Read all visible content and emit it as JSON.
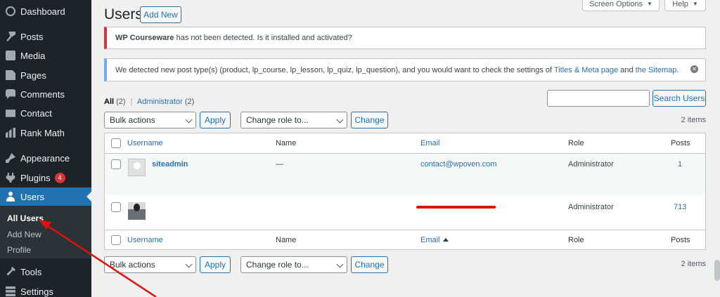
{
  "sidebar": {
    "items": [
      {
        "label": "Dashboard",
        "icon": "dashboard-icon"
      },
      {
        "label": "Posts",
        "icon": "pin-icon"
      },
      {
        "label": "Media",
        "icon": "media-icon"
      },
      {
        "label": "Pages",
        "icon": "pages-icon"
      },
      {
        "label": "Comments",
        "icon": "comments-icon"
      },
      {
        "label": "Contact",
        "icon": "mail-icon"
      },
      {
        "label": "Rank Math",
        "icon": "chart-icon"
      },
      {
        "label": "Appearance",
        "icon": "brush-icon"
      },
      {
        "label": "Plugins",
        "icon": "plug-icon",
        "badge": "4"
      },
      {
        "label": "Users",
        "icon": "user-icon"
      },
      {
        "label": "Tools",
        "icon": "wrench-icon"
      },
      {
        "label": "Settings",
        "icon": "settings-icon"
      }
    ],
    "submenu": [
      "All Users",
      "Add New",
      "Profile"
    ]
  },
  "header": {
    "title": "Users",
    "add_new": "Add New",
    "screen_options": "Screen Options",
    "help": "Help"
  },
  "notices": {
    "error_strong": "WP Courseware",
    "error_text": " has not been detected. Is it installed and activated?",
    "info_text": "We detected new post type(s) (product, lp_course, lp_lesson, lp_quiz, lp_question), and you would want to check the settings of ",
    "info_link1": "Titles & Meta page",
    "info_and": " and ",
    "info_link2": "the Sitemap",
    "info_end": "."
  },
  "filters": {
    "all": "All",
    "all_count": "(2)",
    "sep": "|",
    "admin": "Administrator",
    "admin_count": "(2)"
  },
  "search": {
    "button": "Search Users",
    "placeholder": ""
  },
  "tablenav": {
    "bulk": "Bulk actions",
    "apply": "Apply",
    "role": "Change role to...",
    "change": "Change",
    "items": "2 items"
  },
  "table": {
    "columns": {
      "username": "Username",
      "name": "Name",
      "email": "Email",
      "role": "Role",
      "posts": "Posts"
    },
    "rows": [
      {
        "username": "siteadmin",
        "name": "—",
        "email": "contact@wpoven.com",
        "role": "Administrator",
        "posts": "1"
      },
      {
        "username": "",
        "name": "",
        "email": "",
        "role": "Administrator",
        "posts": "713"
      }
    ]
  },
  "colors": {
    "accent": "#2271b1",
    "sidebar": "#1d2327",
    "annotation": "#e0120c"
  }
}
